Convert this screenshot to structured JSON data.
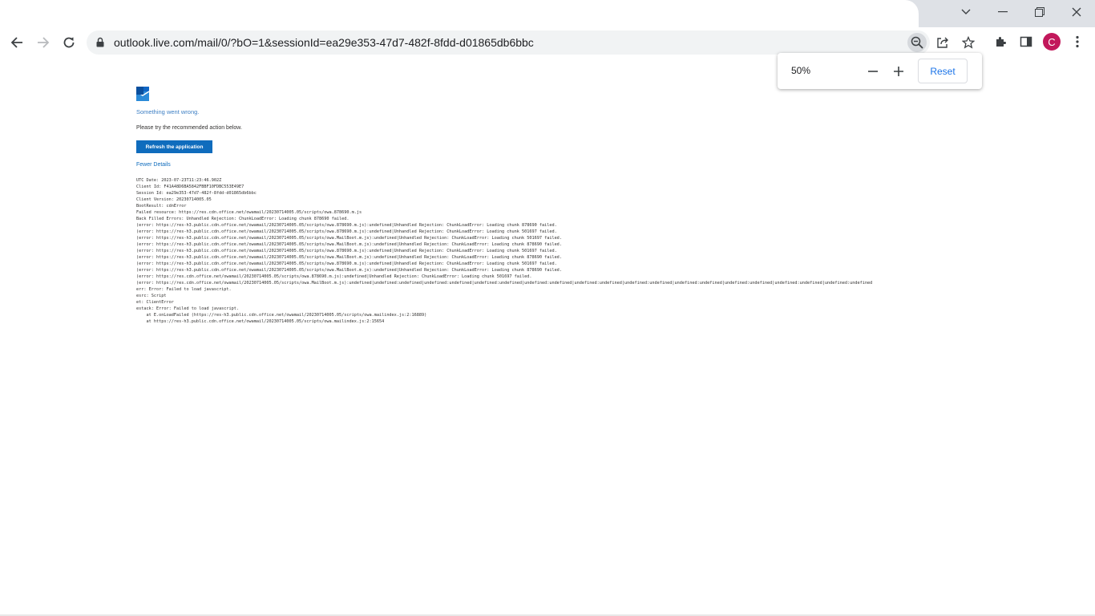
{
  "browser": {
    "url": "outlook.live.com/mail/0/?bO=1&sessionId=ea29e353-47d7-482f-8fdd-d01865db6bbc",
    "profile_initial": "C",
    "zoom_popup": {
      "level": "50%",
      "reset_label": "Reset"
    }
  },
  "page": {
    "error_title": "Something went wrong.",
    "error_subtitle": "Please try the recommended action below.",
    "refresh_label": "Refresh the application",
    "details_toggle": "Fewer Details",
    "details": [
      "UTC Date: 2023-07-23T11:23:46.902Z",
      "Client Id: F41A48D6BA5842FBBF10FDBC553E49E7",
      "Session Id: ea29e353-47d7-482f-8fdd-d01865db6bbc",
      "Client Version: 20230714005.05",
      "BootResult: cdnError",
      "Failed resource: https://res.cdn.office.net/owamail/20230714005.05/scripts/owa.878690.m.js",
      "Back Filled Errors: Unhandled Rejection: ChunkLoadError: Loading chunk 878690 failed.",
      "(error: https://res-h3.public.cdn.office.net/owamail/20230714005.05/scripts/owa.878690.m.js):undefined|Unhandled Rejection: ChunkLoadError: Loading chunk 878690 failed.",
      "(error: https://res-h3.public.cdn.office.net/owamail/20230714005.05/scripts/owa.878690.m.js):undefined|Unhandled Rejection: ChunkLoadError: Loading chunk 501697 failed.",
      "(error: https://res-h3.public.cdn.office.net/owamail/20230714005.05/scripts/owa.MailBoot.m.js):undefined|Unhandled Rejection: ChunkLoadError: Loading chunk 501697 failed.",
      "(error: https://res-h3.public.cdn.office.net/owamail/20230714005.05/scripts/owa.MailBoot.m.js):undefined|Unhandled Rejection: ChunkLoadError: Loading chunk 878690 failed.",
      "(error: https://res-h3.public.cdn.office.net/owamail/20230714005.05/scripts/owa.878690.m.js):undefined|Unhandled Rejection: ChunkLoadError: Loading chunk 501697 failed.",
      "(error: https://res-h3.public.cdn.office.net/owamail/20230714005.05/scripts/owa.MailBoot.m.js):undefined|Unhandled Rejection: ChunkLoadError: Loading chunk 878690 failed.",
      "(error: https://res-h3.public.cdn.office.net/owamail/20230714005.05/scripts/owa.878690.m.js):undefined|Unhandled Rejection: ChunkLoadError: Loading chunk 501697 failed.",
      "(error: https://res-h3.public.cdn.office.net/owamail/20230714005.05/scripts/owa.MailBoot.m.js):undefined|Unhandled Rejection: ChunkLoadError: Loading chunk 878690 failed.",
      "(error: https://res.cdn.office.net/owamail/20230714005.05/scripts/owa.878690.m.js):undefined|Unhandled Rejection: ChunkLoadError: Loading chunk 501697 failed.",
      "(error: https://res.cdn.office.net/owamail/20230714005.05/scripts/owa.MailBoot.m.js):undefined|undefined:undefined|undefined:undefined|undefined:undefined|undefined:undefined|undefined:undefined|undefined:undefined|undefined:undefined|undefined:undefined|undefined:undefined|undefined:undefined",
      "err: Error: Failed to load javascript.",
      "esrc: Script",
      "et: ClientError",
      "estack: Error: Failed to load javascript.",
      "    at E.onLoadFailed (https://res-h3.public.cdn.office.net/owamail/20230714005.05/scripts/owa.mailindex.js:2:16889)",
      "    at https://res-h3.public.cdn.office.net/owamail/20230714005.05/scripts/owa.mailindex.js:2:15654"
    ]
  }
}
